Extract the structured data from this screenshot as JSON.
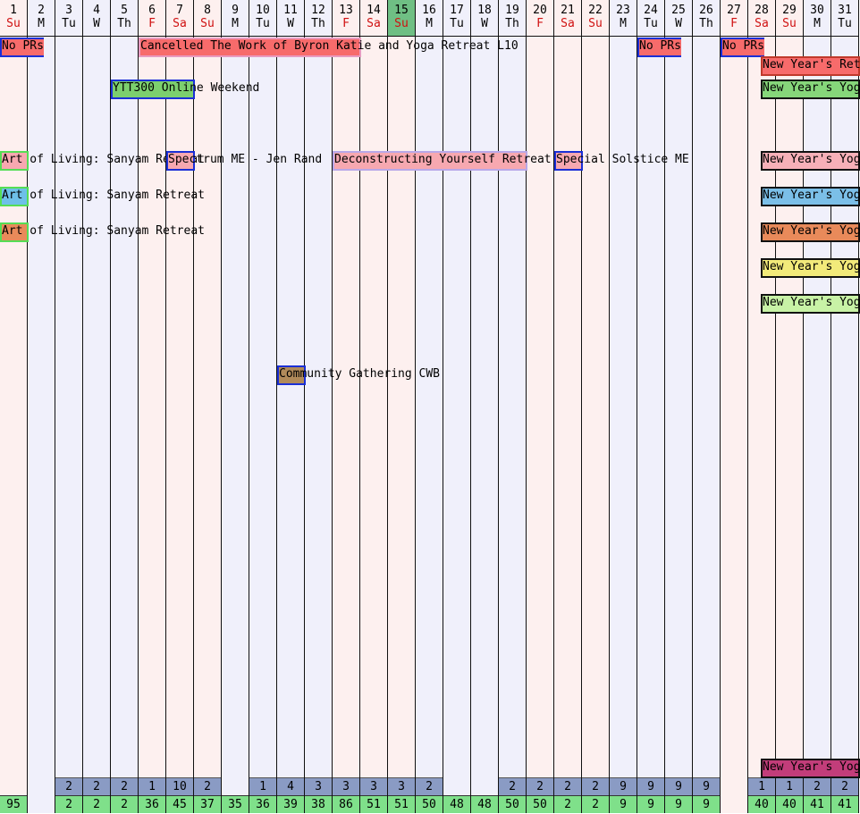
{
  "days": [
    {
      "num": "1",
      "dow": "Su",
      "weekend": true,
      "today": false,
      "count_a": "",
      "count_b": "95"
    },
    {
      "num": "2",
      "dow": "M",
      "weekend": false,
      "today": false,
      "count_a": "",
      "count_b": ""
    },
    {
      "num": "3",
      "dow": "Tu",
      "weekend": false,
      "today": false,
      "count_a": "2",
      "count_b": "2"
    },
    {
      "num": "4",
      "dow": "W",
      "weekend": false,
      "today": false,
      "count_a": "2",
      "count_b": "2"
    },
    {
      "num": "5",
      "dow": "Th",
      "weekend": false,
      "today": false,
      "count_a": "2",
      "count_b": "2"
    },
    {
      "num": "6",
      "dow": "F",
      "weekend": true,
      "today": false,
      "count_a": "1",
      "count_b": "36"
    },
    {
      "num": "7",
      "dow": "Sa",
      "weekend": true,
      "today": false,
      "count_a": "10",
      "count_b": "45"
    },
    {
      "num": "8",
      "dow": "Su",
      "weekend": true,
      "today": false,
      "count_a": "2",
      "count_b": "37"
    },
    {
      "num": "9",
      "dow": "M",
      "weekend": false,
      "today": false,
      "count_a": "",
      "count_b": "35"
    },
    {
      "num": "10",
      "dow": "Tu",
      "weekend": false,
      "today": false,
      "count_a": "1",
      "count_b": "36"
    },
    {
      "num": "11",
      "dow": "W",
      "weekend": false,
      "today": false,
      "count_a": "4",
      "count_b": "39"
    },
    {
      "num": "12",
      "dow": "Th",
      "weekend": false,
      "today": false,
      "count_a": "3",
      "count_b": "38"
    },
    {
      "num": "13",
      "dow": "F",
      "weekend": true,
      "today": false,
      "count_a": "3",
      "count_b": "86"
    },
    {
      "num": "14",
      "dow": "Sa",
      "weekend": true,
      "today": false,
      "count_a": "3",
      "count_b": "51"
    },
    {
      "num": "15",
      "dow": "Su",
      "weekend": true,
      "today": true,
      "count_a": "3",
      "count_b": "51"
    },
    {
      "num": "16",
      "dow": "M",
      "weekend": false,
      "today": false,
      "count_a": "2",
      "count_b": "50"
    },
    {
      "num": "17",
      "dow": "Tu",
      "weekend": false,
      "today": false,
      "count_a": "",
      "count_b": "48"
    },
    {
      "num": "18",
      "dow": "W",
      "weekend": false,
      "today": false,
      "count_a": "",
      "count_b": "48"
    },
    {
      "num": "19",
      "dow": "Th",
      "weekend": false,
      "today": false,
      "count_a": "2",
      "count_b": "50"
    },
    {
      "num": "20",
      "dow": "F",
      "weekend": true,
      "today": false,
      "count_a": "2",
      "count_b": "50"
    },
    {
      "num": "21",
      "dow": "Sa",
      "weekend": true,
      "today": false,
      "count_a": "2",
      "count_b": "2"
    },
    {
      "num": "22",
      "dow": "Su",
      "weekend": true,
      "today": false,
      "count_a": "2",
      "count_b": "2"
    },
    {
      "num": "23",
      "dow": "M",
      "weekend": false,
      "today": false,
      "count_a": "9",
      "count_b": "9"
    },
    {
      "num": "24",
      "dow": "Tu",
      "weekend": false,
      "today": false,
      "count_a": "9",
      "count_b": "9"
    },
    {
      "num": "25",
      "dow": "W",
      "weekend": false,
      "today": false,
      "count_a": "9",
      "count_b": "9"
    },
    {
      "num": "26",
      "dow": "Th",
      "weekend": false,
      "today": false,
      "count_a": "9",
      "count_b": "9"
    },
    {
      "num": "27",
      "dow": "F",
      "weekend": true,
      "today": false,
      "count_a": "",
      "count_b": ""
    },
    {
      "num": "28",
      "dow": "Sa",
      "weekend": true,
      "today": false,
      "count_a": "1",
      "count_b": "40"
    },
    {
      "num": "29",
      "dow": "Su",
      "weekend": true,
      "today": false,
      "count_a": "1",
      "count_b": "40"
    },
    {
      "num": "30",
      "dow": "M",
      "weekend": false,
      "today": false,
      "count_a": "2",
      "count_b": "41"
    },
    {
      "num": "31",
      "dow": "Tu",
      "weekend": false,
      "today": false,
      "count_a": "2",
      "count_b": "41"
    }
  ],
  "events": [
    {
      "label": "No PRs",
      "start": 1,
      "span": 2,
      "row": 0,
      "color": "#f76b6b",
      "border": "#1a2fd6"
    },
    {
      "label": "Cancelled The Work of Byron Katie and Yoga Retreat L10",
      "start": 6,
      "span": 8,
      "row": 0,
      "color": "#f76b6b",
      "border": "#e89ac0"
    },
    {
      "label": "No PRs",
      "start": 24,
      "span": 2,
      "row": 0,
      "color": "#f76b6b",
      "border": "#1a2fd6"
    },
    {
      "label": "No PRs",
      "start": 27,
      "span": 5,
      "row": 0,
      "color": "#f76b6b",
      "border": "#1a2fd6"
    },
    {
      "label": "New Year's Retreat",
      "start": 28,
      "span": 4,
      "row": 1,
      "color": "#f76b6b",
      "border": "#c0392b"
    },
    {
      "label": "YTT300 Online Weekend",
      "start": 5,
      "span": 3,
      "row": 2,
      "color": "#7ccf6e",
      "border": "#1a2fd6"
    },
    {
      "label": "New Year's Yoga",
      "start": 28,
      "span": 4,
      "row": 2,
      "color": "#86d67a",
      "border": "#111111"
    },
    {
      "label": "Art of Living: Sanyam Retreat",
      "start": 1,
      "span": 1,
      "row": 4,
      "color": "#f7a8b0",
      "border": "#55dd55"
    },
    {
      "label": "Spectrum ME - Jen Rand",
      "start": 7,
      "span": 1,
      "row": 4,
      "color": "#f7a8b0",
      "border": "#1a2fd6"
    },
    {
      "label": "Deconstructing Yourself Retreat",
      "start": 13,
      "span": 7,
      "row": 4,
      "color": "#f7a8b0",
      "border": "#b8a8e8"
    },
    {
      "label": "Special Solstice ME",
      "start": 21,
      "span": 1,
      "row": 4,
      "color": "#f7a8b0",
      "border": "#1a2fd6"
    },
    {
      "label": "New Year's Yoga",
      "start": 28,
      "span": 4,
      "row": 4,
      "color": "#f7b0b8",
      "border": "#111111"
    },
    {
      "label": "Art of Living: Sanyam Retreat",
      "start": 1,
      "span": 1,
      "row": 5,
      "color": "#6ec0e8",
      "border": "#55dd55"
    },
    {
      "label": "New Year's Yoga",
      "start": 28,
      "span": 4,
      "row": 5,
      "color": "#7bbfe8",
      "border": "#111111"
    },
    {
      "label": "Art of Living: Sanyam Retreat",
      "start": 1,
      "span": 1,
      "row": 6,
      "color": "#e98a5a",
      "border": "#55dd55"
    },
    {
      "label": "New Year's Yoga",
      "start": 28,
      "span": 4,
      "row": 6,
      "color": "#e98a5a",
      "border": "#111111"
    },
    {
      "label": "New Year's Yoga",
      "start": 28,
      "span": 4,
      "row": 7,
      "color": "#f2ea7a",
      "border": "#111111"
    },
    {
      "label": "New Year's Yoga",
      "start": 28,
      "span": 4,
      "row": 8,
      "color": "#c8f2a6",
      "border": "#111111"
    },
    {
      "label": "Community Gathering CWB",
      "start": 11,
      "span": 1,
      "row": 10,
      "color": "#b08a5a",
      "border": "#1a2fd6"
    },
    {
      "label": "New Year's Yoga",
      "start": 28,
      "span": 4,
      "row": 20,
      "color": "#c23d7a",
      "border": "#111111"
    }
  ]
}
